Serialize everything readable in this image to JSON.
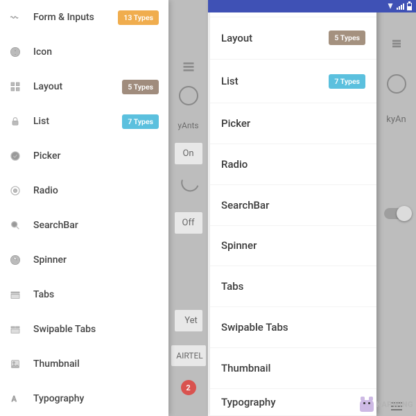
{
  "left": {
    "items": [
      {
        "label": "Form & Inputs",
        "badge": "13 Types",
        "badgeClass": "b-orange",
        "icon": "wave"
      },
      {
        "label": "Icon",
        "icon": "info"
      },
      {
        "label": "Layout",
        "badge": "5 Types",
        "badgeClass": "b-brown",
        "icon": "grid"
      },
      {
        "label": "List",
        "badge": "7 Types",
        "badgeClass": "b-cyan",
        "icon": "lock"
      },
      {
        "label": "Picker",
        "icon": "check"
      },
      {
        "label": "Radio",
        "icon": "dot"
      },
      {
        "label": "SearchBar",
        "icon": "search"
      },
      {
        "label": "Spinner",
        "icon": "nav"
      },
      {
        "label": "Tabs",
        "icon": "tabs"
      },
      {
        "label": "Swipable Tabs",
        "icon": "swipetabs"
      },
      {
        "label": "Thumbnail",
        "icon": "thumb"
      },
      {
        "label": "Typography",
        "icon": "typo"
      }
    ],
    "bgstrip": {
      "yants": "yAnts",
      "on": "On",
      "off": "Off",
      "yet": "Yet",
      "airtel": "AIRTEL",
      "red_badge": "2"
    }
  },
  "right": {
    "items": [
      {
        "label": "Layout",
        "badge": "5 Types",
        "badgeClass": "b-brown2"
      },
      {
        "label": "List",
        "badge": "7 Types",
        "badgeClass": "b-cyan2"
      },
      {
        "label": "Picker"
      },
      {
        "label": "Radio"
      },
      {
        "label": "SearchBar"
      },
      {
        "label": "Spinner"
      },
      {
        "label": "Tabs"
      },
      {
        "label": "Swipable Tabs"
      },
      {
        "label": "Thumbnail"
      },
      {
        "label": "Typography"
      }
    ],
    "bgstrip": {
      "kyan": "kyAn"
    }
  },
  "watermark": "KAPWING"
}
